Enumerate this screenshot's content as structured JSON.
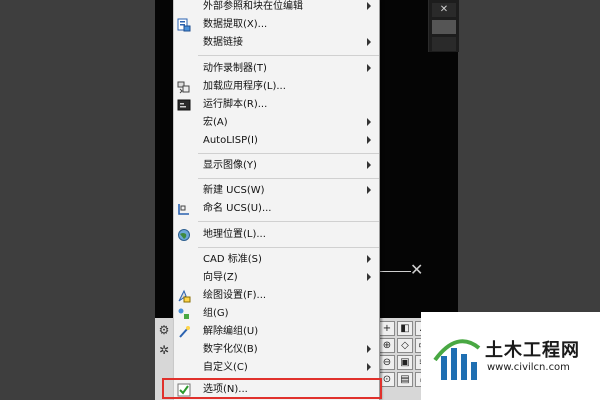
{
  "menu": {
    "items": [
      {
        "label": "外部参照和块在位编辑",
        "icon": "",
        "has_submenu": true
      },
      {
        "label": "数据提取(X)...",
        "icon": "data-extraction-icon",
        "has_submenu": false
      },
      {
        "label": "数据链接",
        "icon": "",
        "has_submenu": true
      },
      {
        "label": "动作录制器(T)",
        "icon": "",
        "has_submenu": true
      },
      {
        "label": "加载应用程序(L)...",
        "icon": "load-application-icon",
        "has_submenu": false
      },
      {
        "label": "运行脚本(R)...",
        "icon": "run-script-icon",
        "has_submenu": false
      },
      {
        "label": "宏(A)",
        "icon": "",
        "has_submenu": true
      },
      {
        "label": "AutoLISP(I)",
        "icon": "",
        "has_submenu": true
      },
      {
        "label": "显示图像(Y)",
        "icon": "",
        "has_submenu": true
      },
      {
        "label": "新建 UCS(W)",
        "icon": "",
        "has_submenu": true
      },
      {
        "label": "命名 UCS(U)...",
        "icon": "named-ucs-icon",
        "has_submenu": false
      },
      {
        "label": "地理位置(L)...",
        "icon": "geographic-location-icon",
        "has_submenu": false
      },
      {
        "label": "CAD 标准(S)",
        "icon": "",
        "has_submenu": true
      },
      {
        "label": "向导(Z)",
        "icon": "",
        "has_submenu": true
      },
      {
        "label": "绘图设置(F)...",
        "icon": "drafting-settings-icon",
        "has_submenu": false
      },
      {
        "label": "组(G)",
        "icon": "group-icon",
        "has_submenu": false
      },
      {
        "label": "解除编组(U)",
        "icon": "ungroup-icon",
        "has_submenu": false
      },
      {
        "label": "数字化仪(B)",
        "icon": "",
        "has_submenu": true
      },
      {
        "label": "自定义(C)",
        "icon": "",
        "has_submenu": true
      },
      {
        "label": "选项(N)...",
        "icon": "options-check-icon",
        "has_submenu": false
      }
    ]
  },
  "watermark": {
    "brand": "土木工程网",
    "url": "www.civilcn.com"
  },
  "colors": {
    "highlight": "#e0312c",
    "menu_bg": "#f3f3f3",
    "canvas_bg": "#050505",
    "logo_blue": "#1f6fb2",
    "logo_green": "#49a843"
  }
}
